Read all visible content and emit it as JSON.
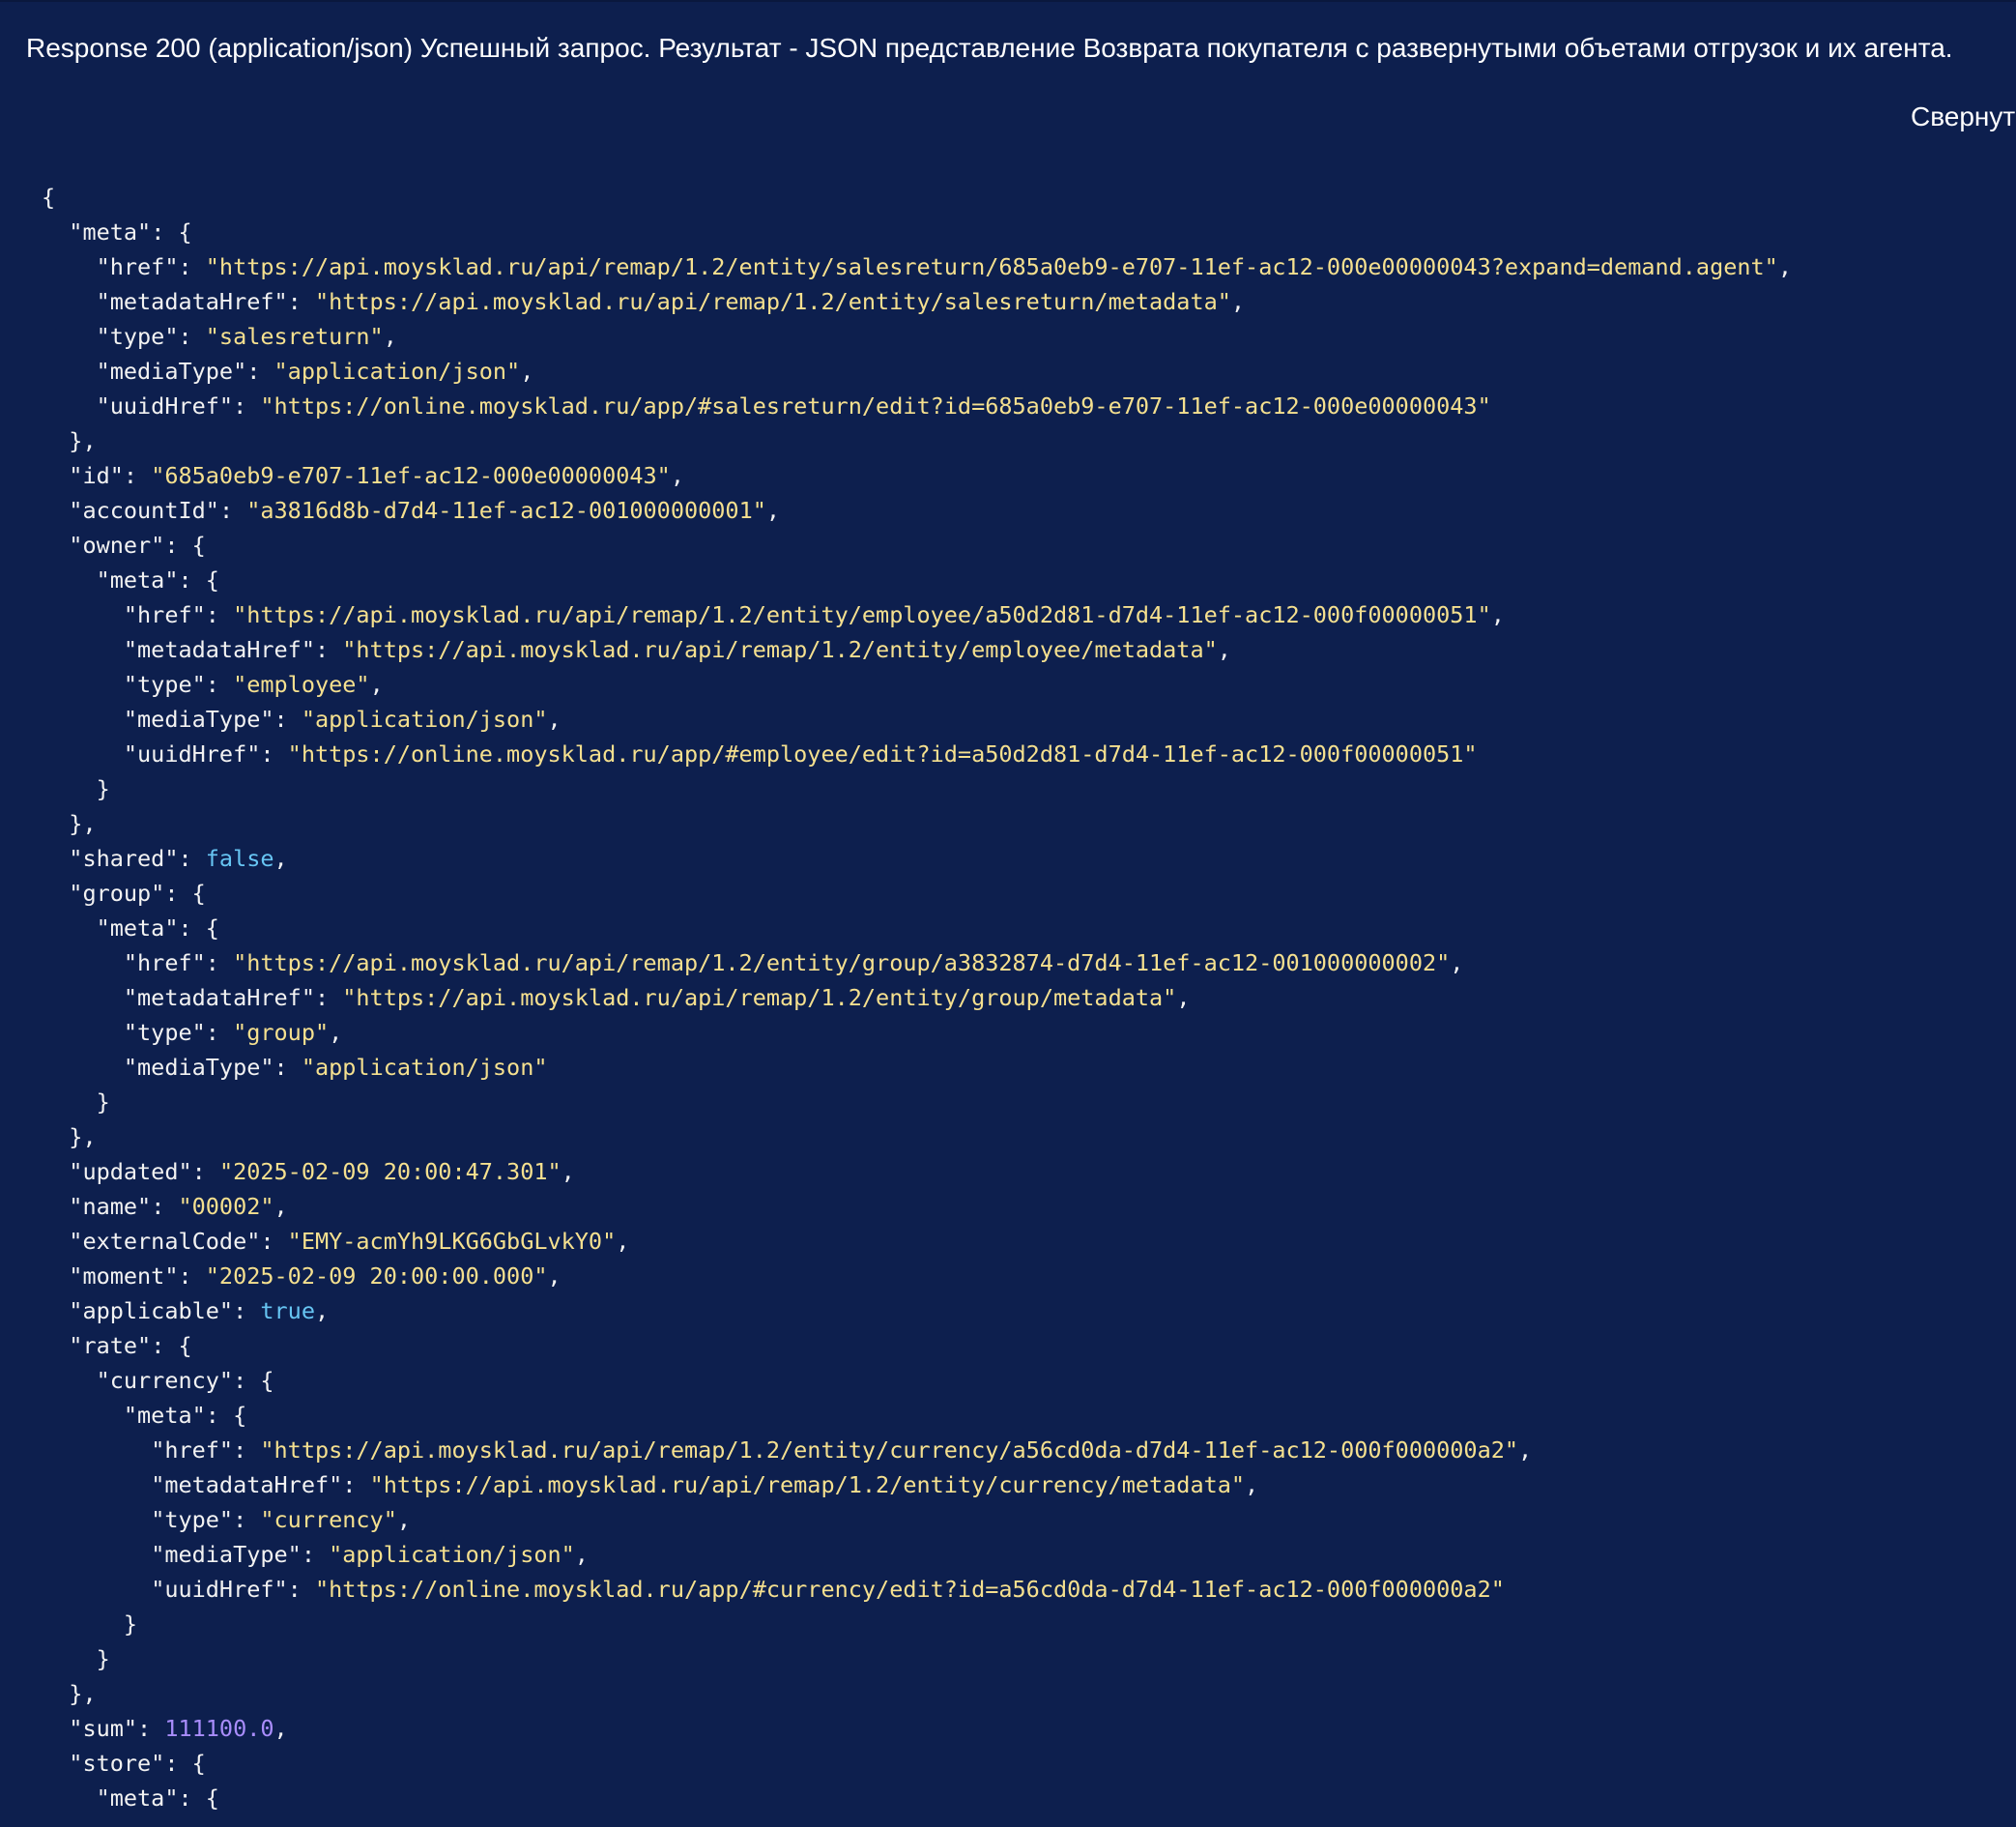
{
  "header": {
    "title": "Response 200 (application/json) Успешный запрос. Результат - JSON представление Возврата покупателя с развернутыми объетами отгрузок и их агента.",
    "collapse_label": "Свернут"
  },
  "colors": {
    "background": "#0d1f4e",
    "key": "#f2f2f2",
    "string": "#f5e08f",
    "boolean": "#67c5f3",
    "number": "#a98dfc"
  },
  "code_lines": [
    {
      "indent": 0,
      "tokens": [
        {
          "t": "p",
          "v": "{"
        }
      ]
    },
    {
      "indent": 1,
      "tokens": [
        {
          "t": "k",
          "v": "\"meta\""
        },
        {
          "t": "p",
          "v": ": {"
        }
      ]
    },
    {
      "indent": 2,
      "tokens": [
        {
          "t": "k",
          "v": "\"href\""
        },
        {
          "t": "p",
          "v": ": "
        },
        {
          "t": "s",
          "v": "\"https://api.moysklad.ru/api/remap/1.2/entity/salesreturn/685a0eb9-e707-11ef-ac12-000e00000043?expand=demand.agent\""
        },
        {
          "t": "p",
          "v": ","
        }
      ]
    },
    {
      "indent": 2,
      "tokens": [
        {
          "t": "k",
          "v": "\"metadataHref\""
        },
        {
          "t": "p",
          "v": ": "
        },
        {
          "t": "s",
          "v": "\"https://api.moysklad.ru/api/remap/1.2/entity/salesreturn/metadata\""
        },
        {
          "t": "p",
          "v": ","
        }
      ]
    },
    {
      "indent": 2,
      "tokens": [
        {
          "t": "k",
          "v": "\"type\""
        },
        {
          "t": "p",
          "v": ": "
        },
        {
          "t": "s",
          "v": "\"salesreturn\""
        },
        {
          "t": "p",
          "v": ","
        }
      ]
    },
    {
      "indent": 2,
      "tokens": [
        {
          "t": "k",
          "v": "\"mediaType\""
        },
        {
          "t": "p",
          "v": ": "
        },
        {
          "t": "s",
          "v": "\"application/json\""
        },
        {
          "t": "p",
          "v": ","
        }
      ]
    },
    {
      "indent": 2,
      "tokens": [
        {
          "t": "k",
          "v": "\"uuidHref\""
        },
        {
          "t": "p",
          "v": ": "
        },
        {
          "t": "s",
          "v": "\"https://online.moysklad.ru/app/#salesreturn/edit?id=685a0eb9-e707-11ef-ac12-000e00000043\""
        }
      ]
    },
    {
      "indent": 1,
      "tokens": [
        {
          "t": "p",
          "v": "},"
        }
      ]
    },
    {
      "indent": 1,
      "tokens": [
        {
          "t": "k",
          "v": "\"id\""
        },
        {
          "t": "p",
          "v": ": "
        },
        {
          "t": "s",
          "v": "\"685a0eb9-e707-11ef-ac12-000e00000043\""
        },
        {
          "t": "p",
          "v": ","
        }
      ]
    },
    {
      "indent": 1,
      "tokens": [
        {
          "t": "k",
          "v": "\"accountId\""
        },
        {
          "t": "p",
          "v": ": "
        },
        {
          "t": "s",
          "v": "\"a3816d8b-d7d4-11ef-ac12-001000000001\""
        },
        {
          "t": "p",
          "v": ","
        }
      ]
    },
    {
      "indent": 1,
      "tokens": [
        {
          "t": "k",
          "v": "\"owner\""
        },
        {
          "t": "p",
          "v": ": {"
        }
      ]
    },
    {
      "indent": 2,
      "tokens": [
        {
          "t": "k",
          "v": "\"meta\""
        },
        {
          "t": "p",
          "v": ": {"
        }
      ]
    },
    {
      "indent": 3,
      "tokens": [
        {
          "t": "k",
          "v": "\"href\""
        },
        {
          "t": "p",
          "v": ": "
        },
        {
          "t": "s",
          "v": "\"https://api.moysklad.ru/api/remap/1.2/entity/employee/a50d2d81-d7d4-11ef-ac12-000f00000051\""
        },
        {
          "t": "p",
          "v": ","
        }
      ]
    },
    {
      "indent": 3,
      "tokens": [
        {
          "t": "k",
          "v": "\"metadataHref\""
        },
        {
          "t": "p",
          "v": ": "
        },
        {
          "t": "s",
          "v": "\"https://api.moysklad.ru/api/remap/1.2/entity/employee/metadata\""
        },
        {
          "t": "p",
          "v": ","
        }
      ]
    },
    {
      "indent": 3,
      "tokens": [
        {
          "t": "k",
          "v": "\"type\""
        },
        {
          "t": "p",
          "v": ": "
        },
        {
          "t": "s",
          "v": "\"employee\""
        },
        {
          "t": "p",
          "v": ","
        }
      ]
    },
    {
      "indent": 3,
      "tokens": [
        {
          "t": "k",
          "v": "\"mediaType\""
        },
        {
          "t": "p",
          "v": ": "
        },
        {
          "t": "s",
          "v": "\"application/json\""
        },
        {
          "t": "p",
          "v": ","
        }
      ]
    },
    {
      "indent": 3,
      "tokens": [
        {
          "t": "k",
          "v": "\"uuidHref\""
        },
        {
          "t": "p",
          "v": ": "
        },
        {
          "t": "s",
          "v": "\"https://online.moysklad.ru/app/#employee/edit?id=a50d2d81-d7d4-11ef-ac12-000f00000051\""
        }
      ]
    },
    {
      "indent": 2,
      "tokens": [
        {
          "t": "p",
          "v": "}"
        }
      ]
    },
    {
      "indent": 1,
      "tokens": [
        {
          "t": "p",
          "v": "},"
        }
      ]
    },
    {
      "indent": 1,
      "tokens": [
        {
          "t": "k",
          "v": "\"shared\""
        },
        {
          "t": "p",
          "v": ": "
        },
        {
          "t": "b",
          "v": "false"
        },
        {
          "t": "p",
          "v": ","
        }
      ]
    },
    {
      "indent": 1,
      "tokens": [
        {
          "t": "k",
          "v": "\"group\""
        },
        {
          "t": "p",
          "v": ": {"
        }
      ]
    },
    {
      "indent": 2,
      "tokens": [
        {
          "t": "k",
          "v": "\"meta\""
        },
        {
          "t": "p",
          "v": ": {"
        }
      ]
    },
    {
      "indent": 3,
      "tokens": [
        {
          "t": "k",
          "v": "\"href\""
        },
        {
          "t": "p",
          "v": ": "
        },
        {
          "t": "s",
          "v": "\"https://api.moysklad.ru/api/remap/1.2/entity/group/a3832874-d7d4-11ef-ac12-001000000002\""
        },
        {
          "t": "p",
          "v": ","
        }
      ]
    },
    {
      "indent": 3,
      "tokens": [
        {
          "t": "k",
          "v": "\"metadataHref\""
        },
        {
          "t": "p",
          "v": ": "
        },
        {
          "t": "s",
          "v": "\"https://api.moysklad.ru/api/remap/1.2/entity/group/metadata\""
        },
        {
          "t": "p",
          "v": ","
        }
      ]
    },
    {
      "indent": 3,
      "tokens": [
        {
          "t": "k",
          "v": "\"type\""
        },
        {
          "t": "p",
          "v": ": "
        },
        {
          "t": "s",
          "v": "\"group\""
        },
        {
          "t": "p",
          "v": ","
        }
      ]
    },
    {
      "indent": 3,
      "tokens": [
        {
          "t": "k",
          "v": "\"mediaType\""
        },
        {
          "t": "p",
          "v": ": "
        },
        {
          "t": "s",
          "v": "\"application/json\""
        }
      ]
    },
    {
      "indent": 2,
      "tokens": [
        {
          "t": "p",
          "v": "}"
        }
      ]
    },
    {
      "indent": 1,
      "tokens": [
        {
          "t": "p",
          "v": "},"
        }
      ]
    },
    {
      "indent": 1,
      "tokens": [
        {
          "t": "k",
          "v": "\"updated\""
        },
        {
          "t": "p",
          "v": ": "
        },
        {
          "t": "s",
          "v": "\"2025-02-09 20:00:47.301\""
        },
        {
          "t": "p",
          "v": ","
        }
      ]
    },
    {
      "indent": 1,
      "tokens": [
        {
          "t": "k",
          "v": "\"name\""
        },
        {
          "t": "p",
          "v": ": "
        },
        {
          "t": "s",
          "v": "\"00002\""
        },
        {
          "t": "p",
          "v": ","
        }
      ]
    },
    {
      "indent": 1,
      "tokens": [
        {
          "t": "k",
          "v": "\"externalCode\""
        },
        {
          "t": "p",
          "v": ": "
        },
        {
          "t": "s",
          "v": "\"EMY-acmYh9LKG6GbGLvkY0\""
        },
        {
          "t": "p",
          "v": ","
        }
      ]
    },
    {
      "indent": 1,
      "tokens": [
        {
          "t": "k",
          "v": "\"moment\""
        },
        {
          "t": "p",
          "v": ": "
        },
        {
          "t": "s",
          "v": "\"2025-02-09 20:00:00.000\""
        },
        {
          "t": "p",
          "v": ","
        }
      ]
    },
    {
      "indent": 1,
      "tokens": [
        {
          "t": "k",
          "v": "\"applicable\""
        },
        {
          "t": "p",
          "v": ": "
        },
        {
          "t": "b",
          "v": "true"
        },
        {
          "t": "p",
          "v": ","
        }
      ]
    },
    {
      "indent": 1,
      "tokens": [
        {
          "t": "k",
          "v": "\"rate\""
        },
        {
          "t": "p",
          "v": ": {"
        }
      ]
    },
    {
      "indent": 2,
      "tokens": [
        {
          "t": "k",
          "v": "\"currency\""
        },
        {
          "t": "p",
          "v": ": {"
        }
      ]
    },
    {
      "indent": 3,
      "tokens": [
        {
          "t": "k",
          "v": "\"meta\""
        },
        {
          "t": "p",
          "v": ": {"
        }
      ]
    },
    {
      "indent": 4,
      "tokens": [
        {
          "t": "k",
          "v": "\"href\""
        },
        {
          "t": "p",
          "v": ": "
        },
        {
          "t": "s",
          "v": "\"https://api.moysklad.ru/api/remap/1.2/entity/currency/a56cd0da-d7d4-11ef-ac12-000f000000a2\""
        },
        {
          "t": "p",
          "v": ","
        }
      ]
    },
    {
      "indent": 4,
      "tokens": [
        {
          "t": "k",
          "v": "\"metadataHref\""
        },
        {
          "t": "p",
          "v": ": "
        },
        {
          "t": "s",
          "v": "\"https://api.moysklad.ru/api/remap/1.2/entity/currency/metadata\""
        },
        {
          "t": "p",
          "v": ","
        }
      ]
    },
    {
      "indent": 4,
      "tokens": [
        {
          "t": "k",
          "v": "\"type\""
        },
        {
          "t": "p",
          "v": ": "
        },
        {
          "t": "s",
          "v": "\"currency\""
        },
        {
          "t": "p",
          "v": ","
        }
      ]
    },
    {
      "indent": 4,
      "tokens": [
        {
          "t": "k",
          "v": "\"mediaType\""
        },
        {
          "t": "p",
          "v": ": "
        },
        {
          "t": "s",
          "v": "\"application/json\""
        },
        {
          "t": "p",
          "v": ","
        }
      ]
    },
    {
      "indent": 4,
      "tokens": [
        {
          "t": "k",
          "v": "\"uuidHref\""
        },
        {
          "t": "p",
          "v": ": "
        },
        {
          "t": "s",
          "v": "\"https://online.moysklad.ru/app/#currency/edit?id=a56cd0da-d7d4-11ef-ac12-000f000000a2\""
        }
      ]
    },
    {
      "indent": 3,
      "tokens": [
        {
          "t": "p",
          "v": "}"
        }
      ]
    },
    {
      "indent": 2,
      "tokens": [
        {
          "t": "p",
          "v": "}"
        }
      ]
    },
    {
      "indent": 1,
      "tokens": [
        {
          "t": "p",
          "v": "},"
        }
      ]
    },
    {
      "indent": 1,
      "tokens": [
        {
          "t": "k",
          "v": "\"sum\""
        },
        {
          "t": "p",
          "v": ": "
        },
        {
          "t": "n",
          "v": "111100.0"
        },
        {
          "t": "p",
          "v": ","
        }
      ]
    },
    {
      "indent": 1,
      "tokens": [
        {
          "t": "k",
          "v": "\"store\""
        },
        {
          "t": "p",
          "v": ": {"
        }
      ]
    },
    {
      "indent": 2,
      "tokens": [
        {
          "t": "k",
          "v": "\"meta\""
        },
        {
          "t": "p",
          "v": ": {"
        }
      ]
    }
  ]
}
